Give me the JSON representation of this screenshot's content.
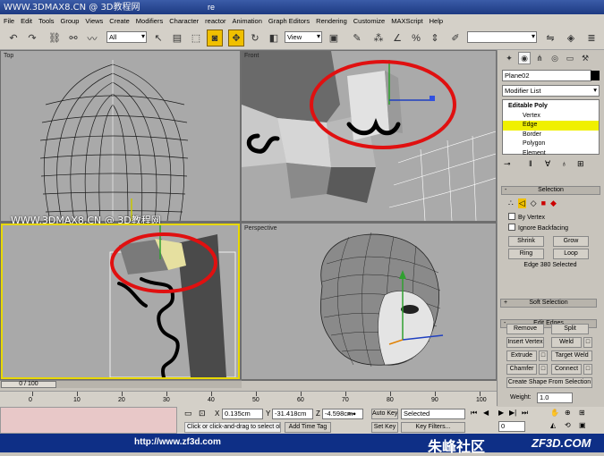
{
  "titlebar": {
    "watermark_left": "WWW.3DMAX8.CN @ 3D教程网",
    "fragment": "re"
  },
  "menu": {
    "items": [
      "File",
      "Edit",
      "Tools",
      "Group",
      "Views",
      "Create",
      "Modifiers",
      "Character",
      "reactor",
      "Animation",
      "Graph Editors",
      "Rendering",
      "Customize",
      "MAXScript",
      "Help"
    ]
  },
  "toolbar": {
    "filter_value": "All",
    "refcoord_value": "View"
  },
  "viewports": {
    "top": "Top",
    "front": "Front",
    "left_label_hidden": "",
    "perspective": "Perspective",
    "watermark_mid": "WWW.3DMAX8.CN @ 3D教程网"
  },
  "command_panel": {
    "object_name": "Plane02",
    "modifier_list": "Modifier List",
    "stack": {
      "root": "Editable Poly",
      "items": [
        "Vertex",
        "Edge",
        "Border",
        "Polygon",
        "Element"
      ],
      "selected_index": 1
    },
    "selection": {
      "title": "Selection",
      "by_vertex": "By Vertex",
      "ignore_backfacing": "Ignore Backfacing",
      "shrink": "Shrink",
      "grow": "Grow",
      "ring": "Ring",
      "loop": "Loop",
      "status": "Edge 380 Selected"
    },
    "soft_selection": {
      "title": "Soft Selection"
    },
    "edit_edges": {
      "title": "Edit Edges",
      "remove": "Remove",
      "split": "Split",
      "insert_vertex": "Insert Vertex",
      "weld": "Weld",
      "extrude": "Extrude",
      "target_weld": "Target Weld",
      "chamfer": "Chamfer",
      "connect": "Connect",
      "create_shape": "Create Shape From Selection",
      "weight_label": "Weight:",
      "weight_value": "1.0"
    }
  },
  "timeline": {
    "frame": "0 / 100",
    "ticks": [
      "0",
      "10",
      "20",
      "30",
      "40",
      "50",
      "60",
      "70",
      "80",
      "90",
      "100"
    ]
  },
  "status": {
    "x_label": "X",
    "x_value": "0.135cm",
    "y_label": "Y",
    "y_value": "-31.418cm",
    "z_label": "Z",
    "z_value": "-4.598cm",
    "prompt": "Click or click-and-drag to select ob",
    "add_time_tag": "Add Time Tag",
    "auto_key": "Auto Key",
    "set_key": "Set Key",
    "key_mode": "Selected",
    "key_filters": "Key Filters...",
    "frame_value": "0"
  },
  "footer": {
    "url": "http://www.zf3d.com",
    "brand_cn": "朱峰社区",
    "brand_en": "ZF3D.COM"
  },
  "colors": {
    "highlight": "#f0f000",
    "annotation": "#e01010",
    "footer": "#0e2f86",
    "viewport_bg": "#a8a8a8"
  }
}
